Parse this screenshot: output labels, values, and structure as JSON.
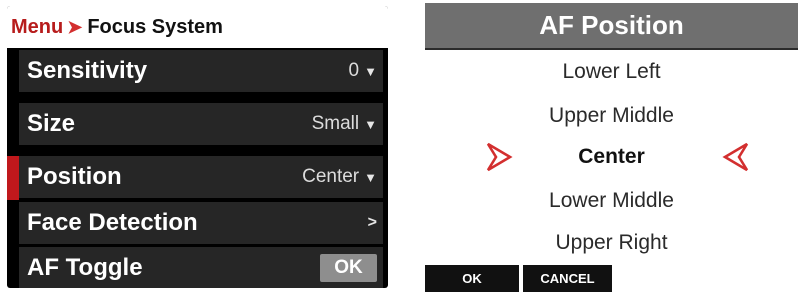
{
  "menu": {
    "breadcrumb": {
      "root": "Menu",
      "separator": "➤",
      "current": "Focus System"
    },
    "items": [
      {
        "label": "Sensitivity",
        "value": "0",
        "indicator": "caret-down"
      },
      {
        "label": "Size",
        "value": "Small",
        "indicator": "caret-down"
      },
      {
        "label": "Position",
        "value": "Center",
        "indicator": "caret-down",
        "selected": true
      },
      {
        "label": "Face Detection",
        "value": "",
        "indicator": "chevron-right"
      },
      {
        "label": "AF Toggle",
        "value": "OK",
        "indicator": "ok-badge"
      }
    ],
    "accent_color": "#c0181c"
  },
  "af_position": {
    "title": "AF Position",
    "options": [
      "Lower Left",
      "Upper Middle",
      "Center",
      "Lower Middle",
      "Upper Right"
    ],
    "selected": "Center",
    "arrow_color": "#d32f2f",
    "softkeys": {
      "ok": "OK",
      "cancel": "CANCEL"
    }
  }
}
